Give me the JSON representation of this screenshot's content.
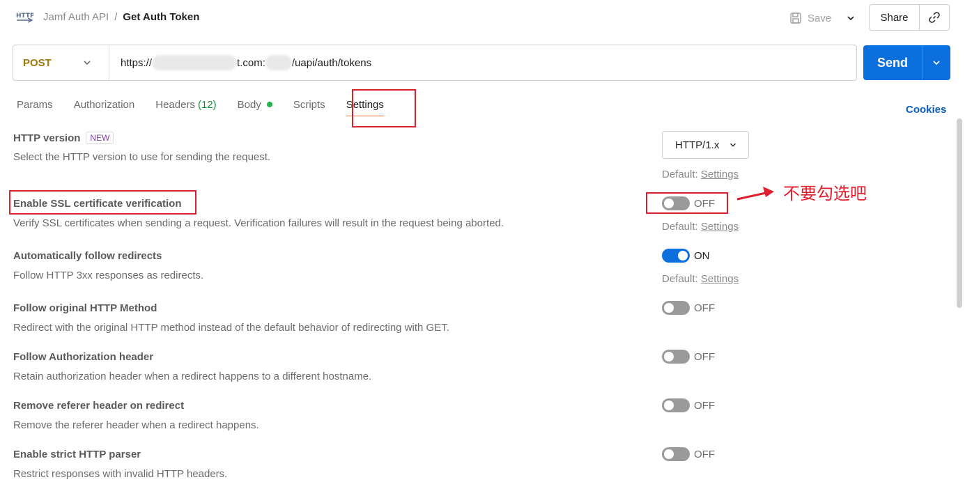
{
  "header": {
    "icon_name": "http-icon",
    "breadcrumb_parent": "Jamf Auth API",
    "breadcrumb_sep": "/",
    "breadcrumb_current": "Get Auth Token",
    "save_label": "Save",
    "share_label": "Share"
  },
  "request": {
    "method": "POST",
    "url_prefix": "https://",
    "url_mid": "t.com:",
    "url_suffix": "/uapi/auth/tokens",
    "send_label": "Send"
  },
  "tabs": [
    {
      "label": "Params"
    },
    {
      "label": "Authorization"
    },
    {
      "label": "Headers",
      "count": "(12)"
    },
    {
      "label": "Body"
    },
    {
      "label": "Scripts"
    },
    {
      "label": "Settings"
    }
  ],
  "cookies_label": "Cookies",
  "settings": {
    "default_label": "Default:",
    "settings_link": "Settings",
    "http_version": {
      "title": "HTTP version",
      "badge": "NEW",
      "desc": "Select the HTTP version to use for sending the request.",
      "value": "HTTP/1.x"
    },
    "rows": [
      {
        "title": "Enable SSL certificate verification",
        "desc": "Verify SSL certificates when sending a request. Verification failures will result in the request being aborted.",
        "state": "OFF"
      },
      {
        "title": "Automatically follow redirects",
        "desc": "Follow HTTP 3xx responses as redirects.",
        "state": "ON"
      },
      {
        "title": "Follow original HTTP Method",
        "desc": "Redirect with the original HTTP method instead of the default behavior of redirecting with GET.",
        "state": "OFF"
      },
      {
        "title": "Follow Authorization header",
        "desc": "Retain authorization header when a redirect happens to a different hostname.",
        "state": "OFF"
      },
      {
        "title": "Remove referer header on redirect",
        "desc": "Remove the referer header when a redirect happens.",
        "state": "OFF"
      },
      {
        "title": "Enable strict HTTP parser",
        "desc": "Restrict responses with invalid HTTP headers.",
        "state": "OFF"
      }
    ]
  },
  "annotation": {
    "text": "不要勾选吧",
    "color": "#e0202f"
  },
  "colors": {
    "accent": "#0b6fde",
    "method": "#a0780a",
    "tab_underline": "#ff6c37"
  }
}
